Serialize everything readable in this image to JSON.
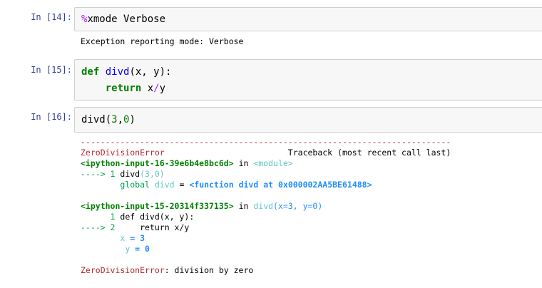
{
  "cells": [
    {
      "prompt": "In [14]:",
      "code": {
        "magic": "%",
        "rest": "xmode Verbose"
      },
      "output": "Exception reporting mode: Verbose"
    },
    {
      "prompt": "In [15]:",
      "code": {
        "kw_def": "def",
        "fname": "divd",
        "params": "(x, y):",
        "indent": "    ",
        "kw_return": "return",
        "expr_x": " x",
        "expr_op": "/",
        "expr_y": "y"
      }
    },
    {
      "prompt": "In [16]:",
      "code": {
        "call": "divd(",
        "arg1": "3",
        "sep": ",",
        "arg2": "0",
        "close": ")"
      },
      "traceback": {
        "dashes": "---------------------------------------------------------------------------",
        "error_name": "ZeroDivisionError",
        "header_spacer": "                         ",
        "header_right": "Traceback (most recent call last)",
        "frame1_file": "<ipython-input-16-39e6b4e8bc6d>",
        "frame1_in": " in ",
        "frame1_module": "<module>",
        "frame1_arrow": "----> 1 ",
        "frame1_code_a": "divd",
        "frame1_code_b": "(3,0)",
        "frame1_global_indent": "        ",
        "frame1_global_kw": "global",
        "frame1_global_name": " divd",
        "frame1_global_eq": " = ",
        "frame1_global_val": "<function divd at 0x000002AA5BE61488>",
        "frame2_file": "<ipython-input-15-20314f337135>",
        "frame2_in": " in ",
        "frame2_func": "divd",
        "frame2_args": "(x=3, y=0)",
        "frame2_line1_prefix": "      1 ",
        "frame2_line1_code": "def divd(x, y):",
        "frame2_arrow": "----> 2 ",
        "frame2_line2_code": "    return x/y",
        "frame2_x_indent": "        ",
        "frame2_x_name": "x",
        "frame2_x_val": " = 3",
        "frame2_y_indent": "         ",
        "frame2_y_name": "y",
        "frame2_y_val": " = 0",
        "final_error": "ZeroDivisionError",
        "final_msg": ": division by zero"
      }
    }
  ]
}
